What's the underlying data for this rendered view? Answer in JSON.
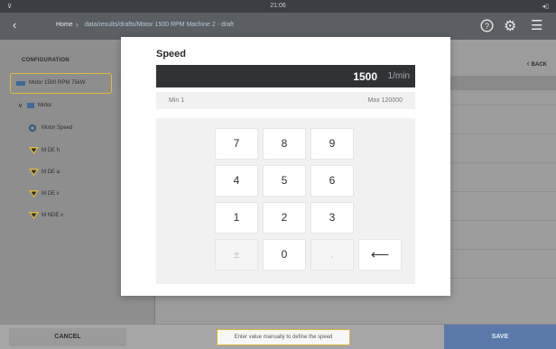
{
  "status_bar": {
    "left": "⊽",
    "time": "21:06",
    "right": "◂▯"
  },
  "nav": {
    "back_icon": "‹",
    "crumb_home": "Home",
    "crumb_separator": "›",
    "crumb_path": "data/results/drafts/Motor 1500 RPM Machine 2 - draft",
    "help_icon": "?",
    "settings_icon": "⚙",
    "menu_icon": "☰"
  },
  "sidebar": {
    "title": "CONFIGURATION",
    "machine_label": "Motor 1500 RPM 75kW",
    "tree": {
      "motor_chevron": "∨",
      "motor_label": "Motor",
      "speed_label": "Motor Speed",
      "points": [
        "M DE h",
        "M DE a",
        "M DE v",
        "M NDE v"
      ]
    }
  },
  "back_link": {
    "icon": "‹",
    "label": "BACK"
  },
  "modal": {
    "title": "Speed",
    "value": "1500",
    "unit": "1/min",
    "min_label": "Min 1",
    "max_label": "Max 120000",
    "keys": {
      "k7": "7",
      "k8": "8",
      "k9": "9",
      "k4": "4",
      "k5": "5",
      "k6": "6",
      "k1": "1",
      "k2": "2",
      "k3": "3",
      "sign": "±",
      "k0": "0",
      "dot": ".",
      "backspace": "⟵"
    }
  },
  "bottom": {
    "cancel": "CANCEL",
    "hint": "Enter value manually to define the speed",
    "save": "SAVE"
  },
  "colors": {
    "accent_yellow": "#e2bb3a",
    "brand_blue": "#5a79a8",
    "value_bar": "#2f3336"
  }
}
